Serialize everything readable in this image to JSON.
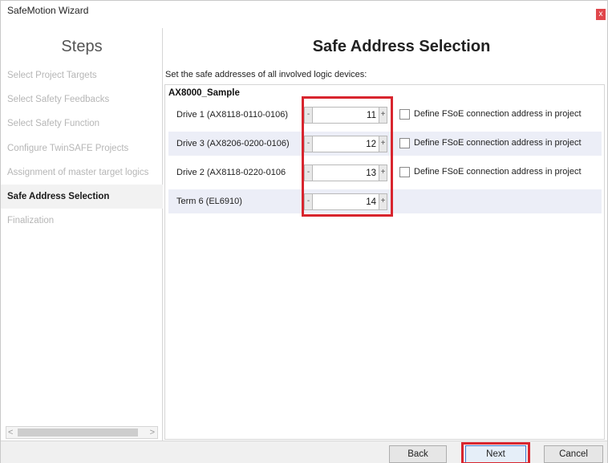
{
  "window": {
    "title": "SafeMotion Wizard",
    "close_glyph": "x"
  },
  "sidebar": {
    "title": "Steps",
    "items": [
      {
        "label": "Select Project Targets",
        "active": false
      },
      {
        "label": "Select Safety Feedbacks",
        "active": false
      },
      {
        "label": "Select Safety Function",
        "active": false
      },
      {
        "label": "Configure TwinSAFE Projects",
        "active": false
      },
      {
        "label": "Assignment of master target logics",
        "active": false
      },
      {
        "label": "Safe Address Selection",
        "active": true
      },
      {
        "label": "Finalization",
        "active": false
      }
    ],
    "scroll_left_glyph": "<",
    "scroll_right_glyph": ">"
  },
  "main": {
    "title": "Safe Address Selection",
    "instruction": "Set the safe addresses of all involved logic devices:",
    "project_name": "AX8000_Sample",
    "devices": [
      {
        "label": "Drive 1 (AX8118-0110-0106)",
        "address": "11",
        "has_checkbox": true,
        "checkbox_label": "Define FSoE connection address in project",
        "checked": false
      },
      {
        "label": "Drive 3 (AX8206-0200-0106)",
        "address": "12",
        "has_checkbox": true,
        "checkbox_label": "Define FSoE connection address in project",
        "checked": false
      },
      {
        "label": "Drive 2  (AX8118-0220-0106",
        "address": "13",
        "has_checkbox": true,
        "checkbox_label": "Define FSoE connection address in project",
        "checked": false
      },
      {
        "label": "Term 6 (EL6910)",
        "address": "14",
        "has_checkbox": false
      }
    ],
    "stepper_minus": "-",
    "stepper_plus": "+"
  },
  "footer": {
    "back_label": "Back",
    "next_label": "Next",
    "cancel_label": "Cancel"
  },
  "colors": {
    "highlight_box": "#d8252e",
    "active_step_bg": "#f2f2f2",
    "row_highlight": "#eceef7",
    "close_button": "#e0474c"
  }
}
